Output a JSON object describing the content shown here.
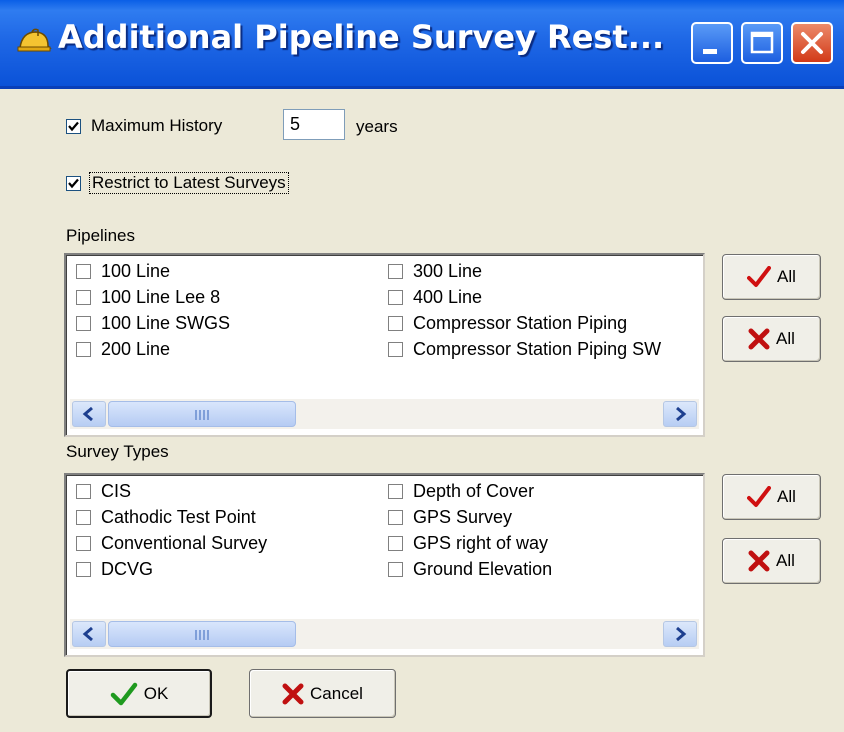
{
  "window": {
    "title": "Additional Pipeline Survey Rest...",
    "icon": "hardhat-icon",
    "controls": [
      "minimize-icon",
      "maximize-icon",
      "close-icon"
    ]
  },
  "max_history": {
    "checkbox_checked": true,
    "label": "Maximum History",
    "value": "5",
    "unit": "years"
  },
  "restrict_latest": {
    "checkbox_checked": true,
    "label": "Restrict to Latest Surveys"
  },
  "pipelines": {
    "label": "Pipelines",
    "items": [
      {
        "label": "100 Line",
        "checked": false
      },
      {
        "label": "100 Line Lee 8",
        "checked": false
      },
      {
        "label": "100 Line SWGS",
        "checked": false
      },
      {
        "label": "200 Line",
        "checked": false
      },
      {
        "label": "300 Line",
        "checked": false
      },
      {
        "label": "400 Line",
        "checked": false
      },
      {
        "label": "Compressor Station Piping",
        "checked": false
      },
      {
        "label": "Compressor Station Piping SW",
        "checked": false
      }
    ],
    "select_all_label": "All",
    "clear_all_label": "All"
  },
  "survey_types": {
    "label": "Survey Types",
    "items": [
      {
        "label": "CIS",
        "checked": false
      },
      {
        "label": "Cathodic Test Point",
        "checked": false
      },
      {
        "label": "Conventional Survey",
        "checked": false
      },
      {
        "label": "DCVG",
        "checked": false
      },
      {
        "label": "Depth of Cover",
        "checked": false
      },
      {
        "label": "GPS Survey",
        "checked": false
      },
      {
        "label": "GPS right of way",
        "checked": false
      },
      {
        "label": "Ground Elevation",
        "checked": false
      }
    ],
    "select_all_label": "All",
    "clear_all_label": "All"
  },
  "buttons": {
    "ok_label": "OK",
    "cancel_label": "Cancel"
  },
  "colors": {
    "titlebar": "#0b52d8",
    "dialog_bg": "#ece9d8",
    "check_green": "#1f9a1f",
    "check_red": "#d01010",
    "cross_red": "#c01010"
  }
}
